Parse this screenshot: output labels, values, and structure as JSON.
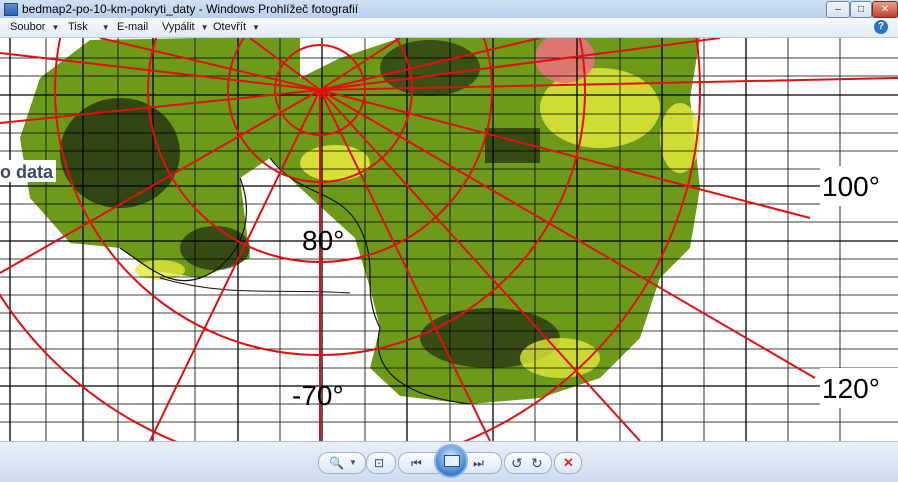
{
  "window": {
    "title": "bedmap2-po-10-km-pokryti_daty - Windows Prohlížeč fotografií",
    "minimize_glyph": "–",
    "maximize_glyph": "□",
    "close_glyph": "✕"
  },
  "menu": {
    "items": [
      {
        "label": "Soubor",
        "has_caret": true
      },
      {
        "label": "Tisk",
        "has_caret": true
      },
      {
        "label": "E-mail",
        "has_caret": false
      },
      {
        "label": "Vypálit",
        "has_caret": true
      },
      {
        "label": "Otevřít",
        "has_caret": true
      }
    ],
    "help_glyph": "?"
  },
  "image": {
    "labels": {
      "lat80": "80°",
      "lat70": "-70°",
      "lon100": "100°",
      "lon120": "120°",
      "partial_text": "o data"
    },
    "colors": {
      "coverage_green": "#6e9a1a",
      "coverage_yellow": "#e2e83a",
      "coverage_red": "#e8737a",
      "grid_red": "#e01010",
      "grid_black": "#000000"
    }
  },
  "toolbar": {
    "buttons": [
      {
        "name": "zoom-icon",
        "glyph": "🔍"
      },
      {
        "name": "actual-size-icon",
        "glyph": "⊡"
      },
      {
        "name": "previous-icon",
        "glyph": "⏮"
      },
      {
        "name": "slideshow-icon",
        "glyph": ""
      },
      {
        "name": "next-icon",
        "glyph": "⏭"
      },
      {
        "name": "rotate-left-icon",
        "glyph": "↺"
      },
      {
        "name": "rotate-right-icon",
        "glyph": "↻"
      },
      {
        "name": "delete-icon",
        "glyph": "✕"
      }
    ]
  }
}
